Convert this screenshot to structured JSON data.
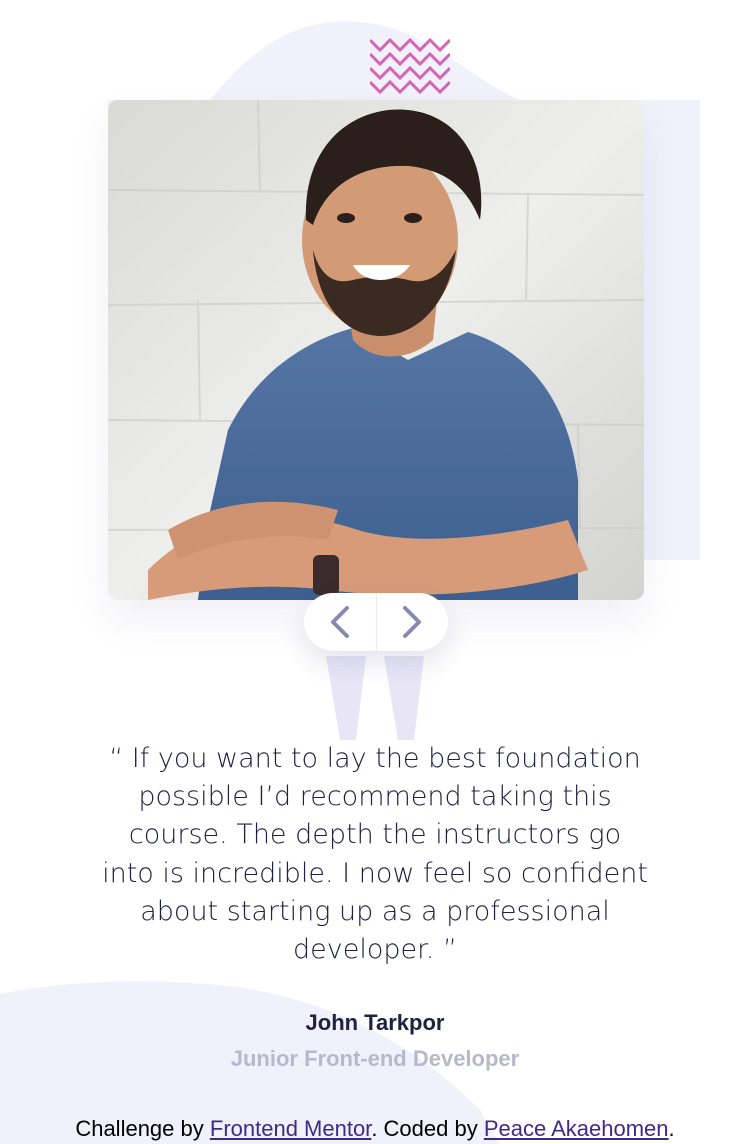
{
  "testimonial": {
    "quote": "“ If you want to lay the best foundation possible I’d recommend taking this course. The depth the instructors go into is incredible. I now feel so confident about starting up as a professional developer. ”",
    "name": "John Tarkpor",
    "role": "Junior Front-end Developer",
    "photo_alt": "John Tarkpor"
  },
  "navigation": {
    "prev_icon": "chevron-left-icon",
    "next_icon": "chevron-right-icon"
  },
  "attribution": {
    "prefix": "Challenge by ",
    "link1": "Frontend Mentor",
    "middle": ". Coded by ",
    "link2": "Peace Akaehomen",
    "suffix": "."
  },
  "colors": {
    "background": "#ffffff",
    "curve": "#f1f1fb",
    "quote_mark": "#e8e6f6",
    "pattern": "#d664b4",
    "chevron": "#8a8ab0",
    "text_dark": "#202040",
    "text_muted": "#b8b8cc",
    "link": "#3d2a8a"
  }
}
